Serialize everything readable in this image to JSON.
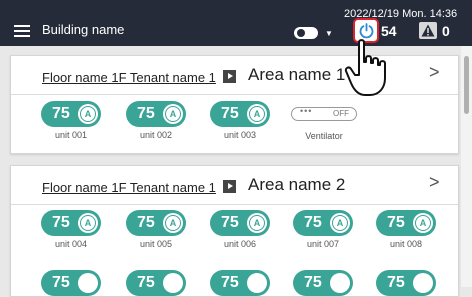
{
  "header": {
    "building_name": "Building name",
    "datetime": "2022/12/19 Mon. 14:36",
    "status_count": "54",
    "warning_count": "0"
  },
  "groups": [
    {
      "floor_tenant": "Floor name 1F Tenant name 1",
      "area": "Area name 1",
      "units": [
        {
          "temp": "75",
          "mode": "A",
          "name": "unit 001"
        },
        {
          "temp": "75",
          "mode": "A",
          "name": "unit 002"
        },
        {
          "temp": "75",
          "mode": "A",
          "name": "unit 003"
        }
      ],
      "ventilator": {
        "dots": "•••",
        "state": "OFF",
        "name": "Ventilator"
      }
    },
    {
      "floor_tenant": "Floor name 1F Tenant name 1",
      "area": "Area name 2",
      "units": [
        {
          "temp": "75",
          "mode": "A",
          "name": "unit 004"
        },
        {
          "temp": "75",
          "mode": "A",
          "name": "unit 005"
        },
        {
          "temp": "75",
          "mode": "A",
          "name": "unit 006"
        },
        {
          "temp": "75",
          "mode": "A",
          "name": "unit 007"
        },
        {
          "temp": "75",
          "mode": "A",
          "name": "unit 008"
        }
      ],
      "next_row_units": [
        {
          "temp": "75"
        },
        {
          "temp": "75"
        },
        {
          "temp": "75"
        },
        {
          "temp": "75"
        },
        {
          "temp": "75"
        }
      ]
    }
  ],
  "colors": {
    "header_bg": "#252b38",
    "unit_on": "#3aa597",
    "power_highlight": "#d9232f"
  }
}
